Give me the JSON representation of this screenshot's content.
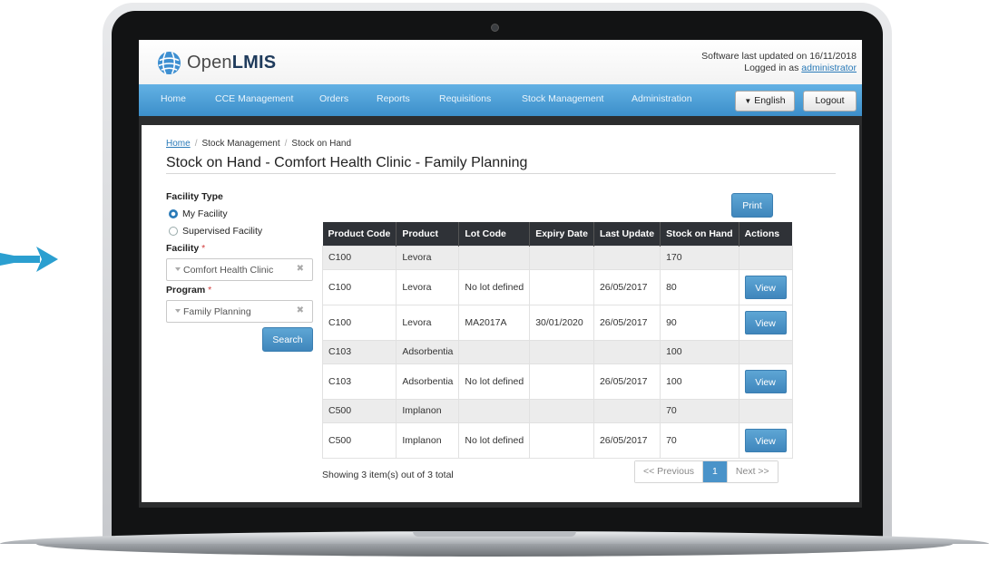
{
  "header": {
    "logo_word_light": "Open",
    "logo_word_bold": "LMIS",
    "updated_text": "Software last updated on 16/11/2018",
    "logged_in_prefix": "Logged in as ",
    "logged_in_user": "administrator"
  },
  "nav": {
    "items": [
      "Home",
      "CCE Management",
      "Orders",
      "Reports",
      "Requisitions",
      "Stock Management",
      "Administration"
    ],
    "language_label": "English",
    "logout_label": "Logout"
  },
  "breadcrumb": [
    "Home",
    "Stock Management",
    "Stock on Hand"
  ],
  "page_title": "Stock on Hand - Comfort Health Clinic - Family Planning",
  "filters": {
    "facility_type_label": "Facility Type",
    "options": [
      "My Facility",
      "Supervised Facility"
    ],
    "selected_option": "My Facility",
    "facility_label": "Facility",
    "facility_value": "Comfort Health Clinic",
    "program_label": "Program",
    "program_value": "Family Planning",
    "required_mark": "*",
    "clear_glyph": "✖",
    "search_label": "Search"
  },
  "print_label": "Print",
  "table": {
    "headers": [
      "Product Code",
      "Product",
      "Lot Code",
      "Expiry Date",
      "Last Update",
      "Stock on Hand",
      "Actions"
    ],
    "view_label": "View",
    "rows": [
      {
        "kind": "summary",
        "code": "C100",
        "product": "Levora",
        "lot": "",
        "expiry": "",
        "updated": "",
        "soh": "170",
        "action": false
      },
      {
        "kind": "lot",
        "code": "C100",
        "product": "Levora",
        "lot": "No lot defined",
        "expiry": "",
        "updated": "26/05/2017",
        "soh": "80",
        "action": true
      },
      {
        "kind": "lot",
        "code": "C100",
        "product": "Levora",
        "lot": "MA2017A",
        "expiry": "30/01/2020",
        "updated": "26/05/2017",
        "soh": "90",
        "action": true
      },
      {
        "kind": "summary",
        "code": "C103",
        "product": "Adsorbentia",
        "lot": "",
        "expiry": "",
        "updated": "",
        "soh": "100",
        "action": false
      },
      {
        "kind": "lot",
        "code": "C103",
        "product": "Adsorbentia",
        "lot": "No lot defined",
        "expiry": "",
        "updated": "26/05/2017",
        "soh": "100",
        "action": true
      },
      {
        "kind": "summary",
        "code": "C500",
        "product": "Implanon",
        "lot": "",
        "expiry": "",
        "updated": "",
        "soh": "70",
        "action": false
      },
      {
        "kind": "lot",
        "code": "C500",
        "product": "Implanon",
        "lot": "No lot defined",
        "expiry": "",
        "updated": "26/05/2017",
        "soh": "70",
        "action": true
      }
    ]
  },
  "pagination": {
    "showing_text": "Showing 3 item(s) out of 3 total",
    "previous_label": "<< Previous",
    "current_page": "1",
    "next_label": "Next >>"
  },
  "colors": {
    "navbar": "#4a9fd8",
    "accent_button": "#4a93c9",
    "arrow": "#2b9fd0",
    "table_header": "#2f3237"
  }
}
